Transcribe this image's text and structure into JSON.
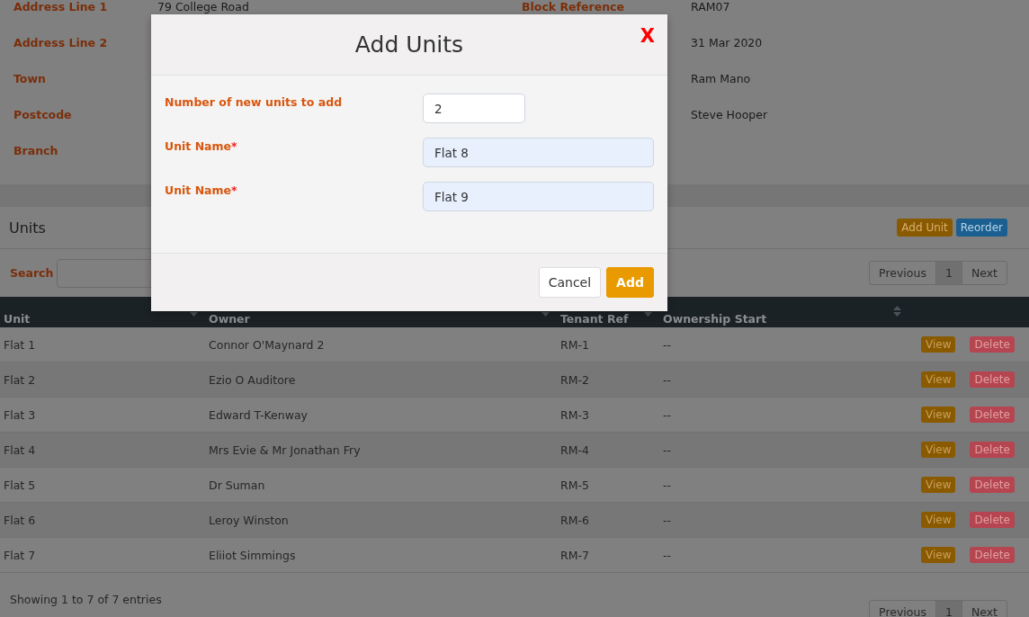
{
  "details": {
    "left": [
      {
        "label": "Address Line 1",
        "value": "79 College Road"
      },
      {
        "label": "Address Line 2"
      },
      {
        "label": "Town"
      },
      {
        "label": "Postcode"
      },
      {
        "label": "Branch"
      }
    ],
    "right": [
      {
        "label": "Block Reference",
        "value": "RAM07"
      },
      {
        "value": "31 Mar 2020"
      },
      {
        "value": "Ram Mano"
      },
      {
        "value": "Steve Hooper"
      }
    ]
  },
  "units_panel": {
    "title": "Units",
    "buttons": [
      {
        "label": "Add Unit",
        "kind": "warning"
      },
      {
        "label": "Reorder",
        "kind": "primary"
      }
    ],
    "search_label": "Search",
    "pagination": [
      {
        "label": "Previous",
        "selected": false
      },
      {
        "label": "1",
        "selected": true
      },
      {
        "label": "Next",
        "selected": false
      }
    ]
  },
  "table": {
    "columns": [
      "Unit",
      "Owner",
      "Tenant Ref",
      "Ownership Start"
    ],
    "rows": [
      {
        "unit": "Flat 1",
        "owner": "Connor O'Maynard 2",
        "tenant_ref": "RM-1",
        "ownership_start": "--",
        "actions": [
          "View",
          "Delete"
        ]
      },
      {
        "unit": "Flat 2",
        "owner": "Ezio O Auditore",
        "tenant_ref": "RM-2",
        "ownership_start": "--",
        "actions": [
          "View",
          "Delete"
        ]
      },
      {
        "unit": "Flat 3",
        "owner": "Edward T-Kenway",
        "tenant_ref": "RM-3",
        "ownership_start": "--",
        "actions": [
          "View",
          "Delete"
        ]
      },
      {
        "unit": "Flat 4",
        "owner": "Mrs Evie & Mr Jonathan Fry",
        "tenant_ref": "RM-4",
        "ownership_start": "--",
        "actions": [
          "View",
          "Delete"
        ]
      },
      {
        "unit": "Flat 5",
        "owner": "Dr Suman",
        "tenant_ref": "RM-5",
        "ownership_start": "--",
        "actions": [
          "View",
          "Delete"
        ]
      },
      {
        "unit": "Flat 6",
        "owner": "Leroy Winston",
        "tenant_ref": "RM-6",
        "ownership_start": "--",
        "actions": [
          "View",
          "Delete"
        ]
      },
      {
        "unit": "Flat 7",
        "owner": "Eliiot Simmings",
        "tenant_ref": "RM-7",
        "ownership_start": "--",
        "actions": [
          "View",
          "Delete"
        ]
      }
    ]
  },
  "footer": {
    "info": "Showing 1 to 7 of 7 entries",
    "pagination": [
      {
        "label": "Previous",
        "selected": false
      },
      {
        "label": "1",
        "selected": true
      },
      {
        "label": "Next",
        "selected": false
      }
    ]
  },
  "modal": {
    "title": "Add Units",
    "close": "X",
    "fields": [
      {
        "label": "Number of new units to add",
        "value": "2",
        "kind": "number"
      },
      {
        "label": "Unit Name",
        "required_mark": "*",
        "value": "Flat 8",
        "kind": "text"
      },
      {
        "label": "Unit Name",
        "required_mark": "*",
        "value": "Flat 9",
        "kind": "text"
      }
    ],
    "buttons": [
      {
        "label": "Cancel",
        "kind": "default"
      },
      {
        "label": "Add",
        "kind": "primary"
      }
    ]
  }
}
